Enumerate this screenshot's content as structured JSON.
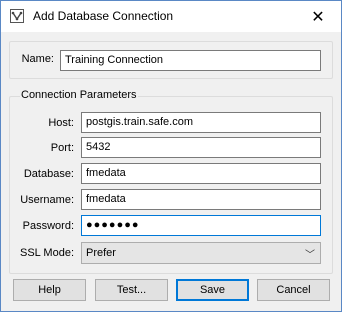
{
  "window": {
    "title": "Add Database Connection",
    "close_glyph": "✕",
    "icon": "database-connection-icon"
  },
  "name_group": {
    "label": "Name:",
    "value": "Training Connection"
  },
  "params_group": {
    "legend": "Connection Parameters",
    "host_label": "Host:",
    "host_value": "postgis.train.safe.com",
    "port_label": "Port:",
    "port_value": "5432",
    "database_label": "Database:",
    "database_value": "fmedata",
    "username_label": "Username:",
    "username_value": "fmedata",
    "password_label": "Password:",
    "password_value": "●●●●●●●",
    "ssl_label": "SSL Mode:",
    "ssl_value": "Prefer",
    "ssl_chevron": "﹀"
  },
  "buttons": {
    "help": "Help",
    "test": "Test...",
    "save": "Save",
    "cancel": "Cancel"
  },
  "colors": {
    "accent": "#0078d7",
    "window_border": "#5a88c5"
  }
}
